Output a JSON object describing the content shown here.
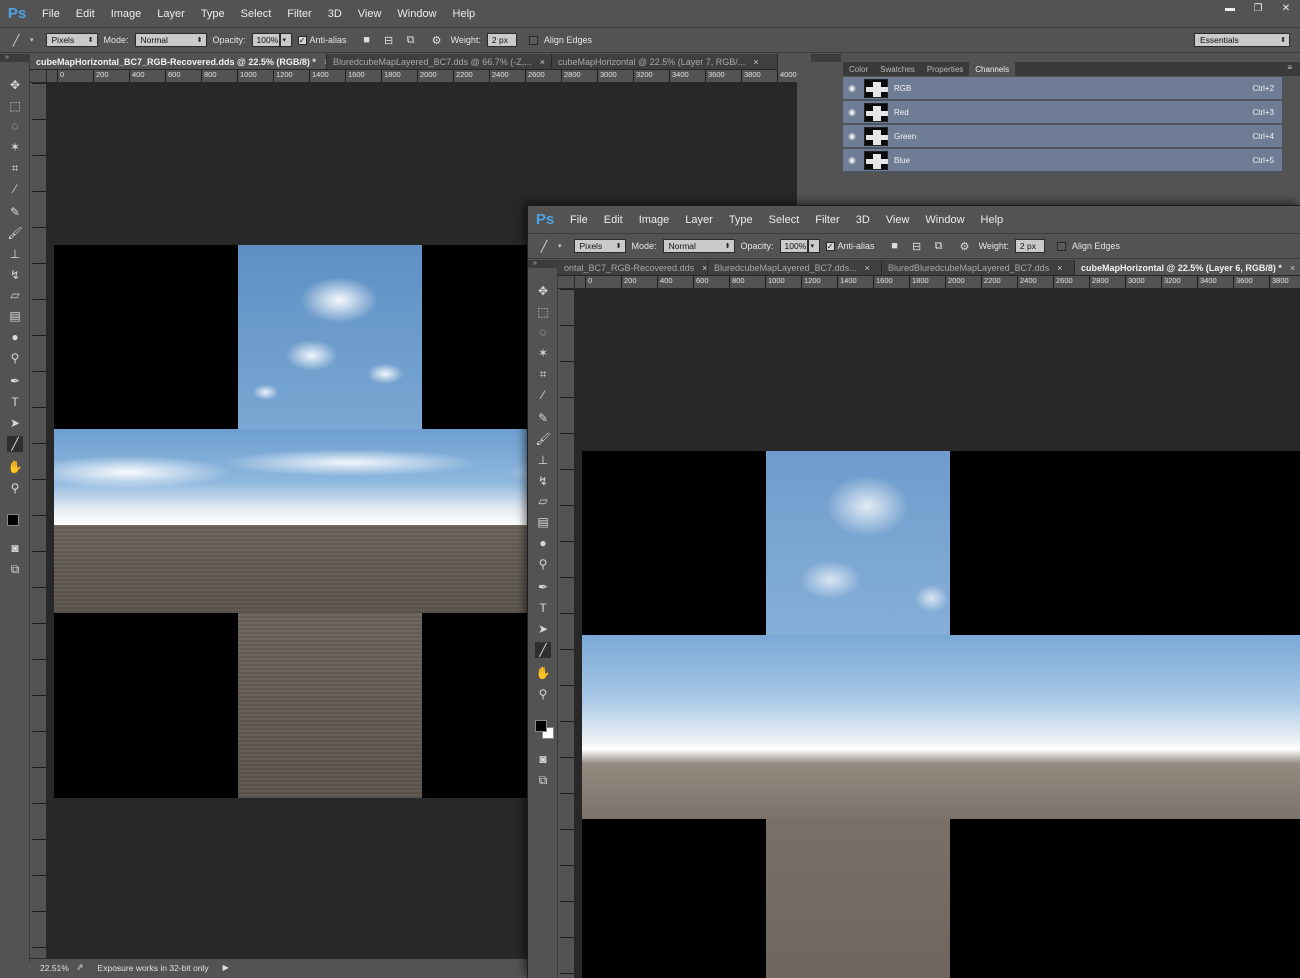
{
  "app": {
    "logo": "Ps"
  },
  "menu": [
    "File",
    "Edit",
    "Image",
    "Layer",
    "Type",
    "Select",
    "Filter",
    "3D",
    "View",
    "Window",
    "Help"
  ],
  "window_controls": {
    "minimize": "▬",
    "restore": "❐",
    "close": "✕"
  },
  "options": {
    "shape_mode": "Pixels",
    "mode_label": "Mode:",
    "mode_value": "Normal",
    "opacity_label": "Opacity:",
    "opacity_value": "100%",
    "antialias_label": "Anti-alias",
    "weight_label": "Weight:",
    "weight_value": "2 px",
    "align_edges_label": "Align Edges",
    "workspace": "Essentials"
  },
  "window1": {
    "tabs": [
      {
        "label": "cubeMapHorizontal_BC7_RGB-Recovered.dds @ 22.5% (RGB/8) *",
        "active": true
      },
      {
        "label": "BluredcubeMapLayered_BC7.dds @ 66.7% (-Z,...",
        "active": false
      },
      {
        "label": "cubeMapHorizontal @ 22.5% (Layer 7, RGB/...",
        "active": false
      }
    ],
    "ruler": [
      "0",
      "200",
      "400",
      "600",
      "800",
      "1000",
      "1200",
      "1400",
      "1600",
      "1800",
      "2000",
      "2200",
      "2400",
      "2600",
      "2800",
      "3000",
      "3200",
      "3400",
      "3600",
      "3800",
      "4000"
    ],
    "status": {
      "zoom": "22.51%",
      "info": "Exposure works in 32-bit only"
    }
  },
  "window2": {
    "tabs": [
      {
        "label": "ontal_BC7_RGB-Recovered.dds",
        "active": false
      },
      {
        "label": "BluredcubeMapLayered_BC7.dds...",
        "active": false
      },
      {
        "label": "BluredBluredcubeMapLayered_BC7.dds",
        "active": false
      },
      {
        "label": "cubeMapHorizontal @ 22.5% (Layer 6, RGB/8) *",
        "active": true
      }
    ],
    "ruler": [
      "0",
      "200",
      "400",
      "600",
      "800",
      "1000",
      "1200",
      "1400",
      "1600",
      "1800",
      "2000",
      "2200",
      "2400",
      "2600",
      "2800",
      "3000",
      "3200",
      "3400",
      "3600",
      "3800"
    ]
  },
  "panel": {
    "tabs": [
      "Color",
      "Swatches",
      "Properties",
      "Channels"
    ],
    "active_tab": "Channels",
    "channels": [
      {
        "name": "RGB",
        "shortcut": "Ctrl+2"
      },
      {
        "name": "Red",
        "shortcut": "Ctrl+3"
      },
      {
        "name": "Green",
        "shortcut": "Ctrl+4"
      },
      {
        "name": "Blue",
        "shortcut": "Ctrl+5"
      }
    ]
  },
  "tab_close": "×",
  "colors": {
    "chrome": "#535353",
    "canvas": "#282828",
    "channel_selected": "#6e7c95",
    "accent": "#4ea2e6"
  }
}
